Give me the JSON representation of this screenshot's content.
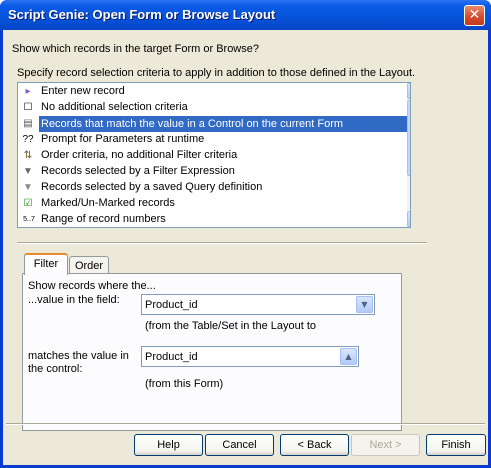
{
  "window": {
    "title": "Script Genie:  Open Form or Browse Layout",
    "close_glyph": "✕"
  },
  "prompt": "Show which records in the target Form or Browse?",
  "criteria_label": "Specify record selection criteria to apply in addition to those defined in the Layout.",
  "list": {
    "items": [
      {
        "label": "Enter new record",
        "icon": "new-record-icon",
        "glyph": "▸",
        "color": "#7a5fd0"
      },
      {
        "label": "No additional selection criteria",
        "icon": "empty-checkbox-icon",
        "glyph": "☐",
        "color": "#000000"
      },
      {
        "label": "Records that match the value in a Control on the current Form",
        "icon": "form-control-icon",
        "glyph": "▤",
        "color": "#555555",
        "selected": true
      },
      {
        "label": "Prompt for Parameters at runtime",
        "icon": "parameter-icon",
        "glyph": "??",
        "color": "#000000"
      },
      {
        "label": "Order criteria, no additional Filter criteria",
        "icon": "sort-order-icon",
        "glyph": "⇅",
        "color": "#6d5a2a"
      },
      {
        "label": "Records selected by a Filter Expression",
        "icon": "filter-expression-icon",
        "glyph": "▼",
        "color": "#666666"
      },
      {
        "label": "Records selected by a saved Query definition",
        "icon": "funnel-icon",
        "glyph": "▼",
        "color": "#888888"
      },
      {
        "label": "Marked/Un-Marked records",
        "icon": "checked-box-icon",
        "glyph": "☑",
        "color": "#1a8a1a"
      },
      {
        "label": "Range of record numbers",
        "icon": "range-icon",
        "glyph": "5..7",
        "color": "#000000"
      }
    ]
  },
  "tabs": [
    {
      "label": "Filter"
    },
    {
      "label": "Order"
    }
  ],
  "filter": {
    "show_records": "Show records where the...",
    "value_label": "...value in the field:",
    "field_value": "Product_id",
    "field_hint": "(from the Table/Set in the Layout to",
    "matches_label_1": "matches the value in",
    "matches_label_2": "the control:",
    "control_value": "Product_id",
    "control_hint": "(from this Form)"
  },
  "buttons": {
    "help": "Help",
    "cancel": "Cancel",
    "back": "< Back",
    "next": "Next >",
    "finish": "Finish"
  }
}
